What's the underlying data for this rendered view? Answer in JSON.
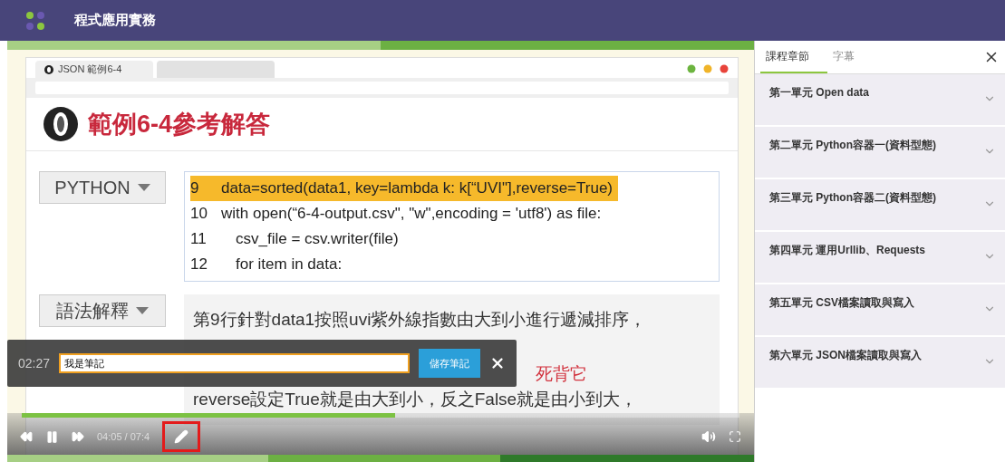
{
  "app": {
    "title": "程式應用實務"
  },
  "slide": {
    "browser_tab": "JSON 範例6-4",
    "title": "範例6-4參考解答",
    "sections": [
      {
        "kind": "code",
        "dropdown": "PYTHON",
        "lines": [
          {
            "number": "9",
            "code": "data=sorted(data1, key=lambda k: k[“UVI\"],reverse=True)",
            "highlighted": true
          },
          {
            "number": "10",
            "code": "with open(“6-4-output.csv\", \"w\",encoding = 'utf8') as file:",
            "highlighted": false
          },
          {
            "number": "11",
            "code": "csv_file = csv.writer(file)",
            "highlighted": false
          },
          {
            "number": "12",
            "code": "for item in data:",
            "highlighted": false
          }
        ]
      },
      {
        "kind": "text",
        "dropdown": "語法解釋",
        "paragraphs": [
          {
            "text": "第9行針對data1按照uvi紫外線指數由大到小進行遞減排序，",
            "emphasis": false
          },
          {
            "text": "死背它",
            "emphasis": true
          },
          {
            "text": "reverse設定True就是由大到小，反之False就是由小到大，",
            "emphasis": false
          }
        ]
      }
    ]
  },
  "note": {
    "time": "02:27",
    "value": "我是筆記",
    "save_button": "儲存筆記"
  },
  "player": {
    "playing": true,
    "progress": {
      "level": 0.52
    },
    "time": "04:05 / 07:4",
    "note_button_highlighted": true
  },
  "panel": {
    "tabs": [
      {
        "label": "課程章節",
        "selected": true
      },
      {
        "label": "字幕",
        "selected": false
      }
    ],
    "chapters": [
      {
        "title": "第一單元 Open data"
      },
      {
        "title": "第二單元 Python容器一(資料型態)"
      },
      {
        "title": "第三單元 Python容器二(資料型態)"
      },
      {
        "title": "第四單元 運用Urllib、Requests"
      },
      {
        "title": "第五單元 CSV檔案讀取與寫入"
      },
      {
        "title": "第六單元 JSON檔案讀取與寫入"
      }
    ]
  }
}
